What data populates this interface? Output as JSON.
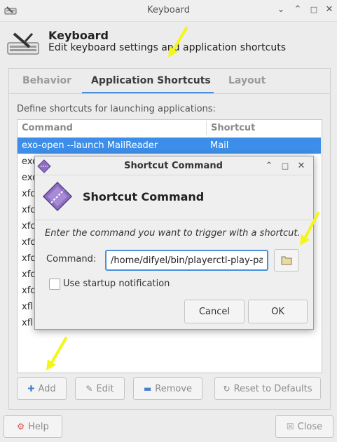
{
  "window": {
    "title": "Keyboard",
    "app_icon": "keyboard-settings-icon",
    "controls": [
      "minimize-icon",
      "maximize-icon",
      "close-icon"
    ]
  },
  "header": {
    "title": "Keyboard",
    "subtitle": "Edit keyboard settings and application shortcuts",
    "icon": "keyboard-settings-icon"
  },
  "tabs": [
    {
      "label": "Behavior",
      "active": false
    },
    {
      "label": "Application Shortcuts",
      "active": true
    },
    {
      "label": "Layout",
      "active": false
    }
  ],
  "shortcuts": {
    "description": "Define shortcuts for launching applications:",
    "columns": [
      "Command",
      "Shortcut"
    ],
    "rows": [
      {
        "command": "exo-open --launch MailReader",
        "shortcut": "Mail",
        "selected": true
      },
      {
        "command": "exo",
        "shortcut": ""
      },
      {
        "command": "exo",
        "shortcut": ""
      },
      {
        "command": "xfc",
        "shortcut": ""
      },
      {
        "command": "xfc",
        "shortcut": ""
      },
      {
        "command": "xfc",
        "shortcut": ""
      },
      {
        "command": "xfc",
        "shortcut": ""
      },
      {
        "command": "xfc",
        "shortcut": ""
      },
      {
        "command": "xfc",
        "shortcut": ""
      },
      {
        "command": "xfc",
        "shortcut": ""
      },
      {
        "command": "xfl",
        "shortcut": ""
      },
      {
        "command": "xfl",
        "shortcut": ""
      }
    ],
    "buttons": {
      "add": "Add",
      "edit": "Edit",
      "remove": "Remove",
      "reset": "Reset to Defaults"
    }
  },
  "footer": {
    "help": "Help",
    "close": "Close"
  },
  "dialog": {
    "window_title": "Shortcut Command",
    "heading": "Shortcut Command",
    "prompt": "Enter the command you want to trigger with a shortcut.",
    "command_label": "Command:",
    "command_value": "/home/difyel/bin/playerctl-play-pa",
    "startup_notification_label": "Use startup notification",
    "startup_notification_checked": false,
    "cancel": "Cancel",
    "ok": "OK"
  },
  "colors": {
    "selection": "#3d8ee8",
    "accent": "#4a90d9",
    "annotation_arrow": "#f5f51a"
  }
}
